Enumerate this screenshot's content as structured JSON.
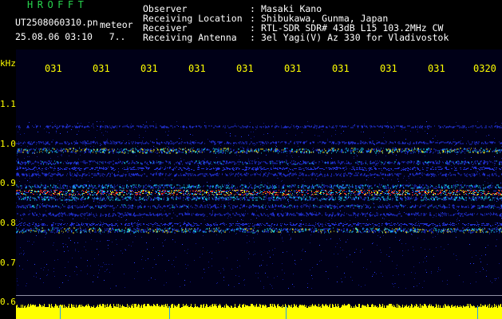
{
  "header": {
    "brand": "HROFFT",
    "file_name": "UT2508060310.pn",
    "meteor_label": "meteor",
    "date_time": "25.08.06 03:10   7..",
    "meta": [
      {
        "label": "Observer",
        "value": "Masaki Kano"
      },
      {
        "label": "Receiving Location",
        "value": "Shibukawa, Gunma, Japan"
      },
      {
        "label": "Receiver",
        "value": "RTL-SDR SDR# 43dB L15 103.2MHz CW"
      },
      {
        "label": "Receiving Antenna",
        "value": "3el Yagi(V) Az 330 for Vladivostok"
      }
    ],
    "separator": ":"
  },
  "axes": {
    "y_unit": "kHz",
    "y_ticks": [
      "1.1",
      "1",
      "0.9",
      "0.8",
      "0.7",
      "0.6"
    ],
    "y_tick_display": [
      "1.1",
      "1.0",
      "0.9",
      "0.8",
      "0.7",
      "0.6"
    ],
    "x_ticks": [
      "031",
      "031",
      "031",
      "031",
      "031",
      "031",
      "031",
      "031",
      "031",
      "0320"
    ]
  },
  "spectrogram": {
    "colors": {
      "background": "#000017",
      "weak": "#2030d0",
      "medium": "#18c8e8",
      "strong": "#e8e020",
      "peak": "#ff3020",
      "power": "#ffff00",
      "power_marker": "#2aa0e8"
    },
    "bands_khz": [
      1.045,
      1.005,
      0.985,
      0.955,
      0.94,
      0.925,
      0.895,
      0.88,
      0.865,
      0.845,
      0.825,
      0.8,
      0.785
    ]
  }
}
